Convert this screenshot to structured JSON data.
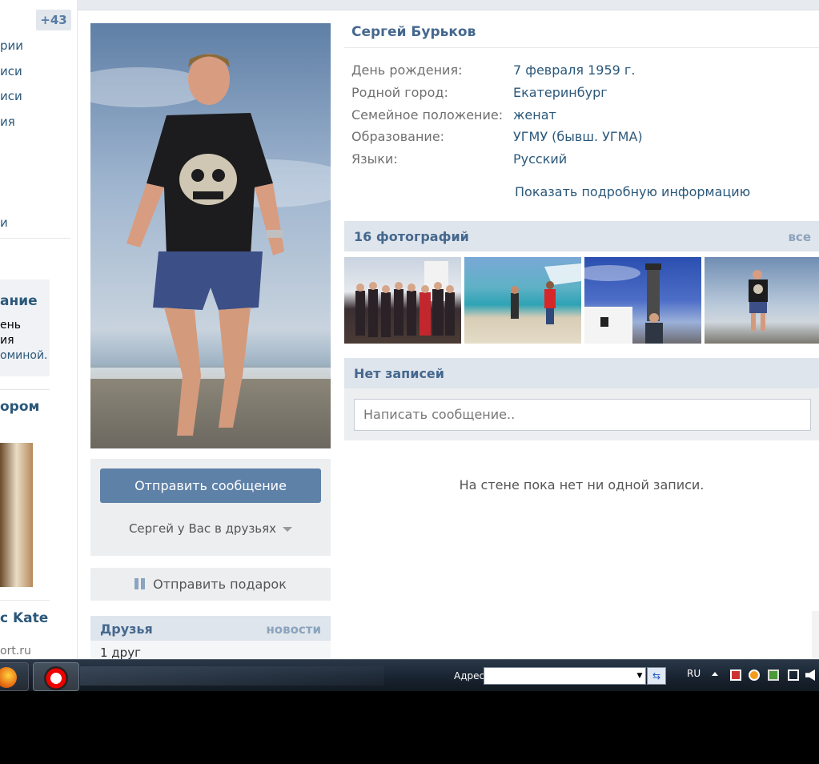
{
  "left_sidebar": {
    "badge": "+43",
    "menu": [
      "рии",
      "иси",
      "иси",
      "ия"
    ],
    "menu_last": "и",
    "box_title": "ание",
    "box_lines": [
      "ень",
      "ия",
      "оминой."
    ],
    "promo_title": "ором",
    "kate_title": "с Kate",
    "site": "ort.ru"
  },
  "profile": {
    "name": "Сергей Бурьков",
    "info": [
      {
        "label": "День рождения:",
        "value": "7 февраля 1959 г."
      },
      {
        "label": "Родной город:",
        "value": "Екатеринбург"
      },
      {
        "label": "Семейное положение:",
        "value": "женат"
      },
      {
        "label": "Образование:",
        "value": "УГМУ (бывш. УГМА)"
      },
      {
        "label": "Языки:",
        "value": "Русский"
      }
    ],
    "more_link": "Показать подробную информацию"
  },
  "actions": {
    "send_message": "Отправить сообщение",
    "friend_status": "Сергей у Вас в друзьях",
    "send_gift": "Отправить подарок"
  },
  "friends": {
    "title": "Друзья",
    "news_link": "новости",
    "count": "1 друг"
  },
  "photos": {
    "title": "16 фотографий",
    "all_link": "все"
  },
  "wall": {
    "title": "Нет записей",
    "placeholder": "Написать сообщение..",
    "empty_text": "На стене пока нет ни одной записи."
  },
  "taskbar": {
    "address_label": "Адрес",
    "lang": "RU"
  },
  "colors": {
    "link": "#2b587a",
    "header_blue": "#45688e",
    "button": "#5e81a8",
    "block_bg": "#dfe5ec"
  }
}
